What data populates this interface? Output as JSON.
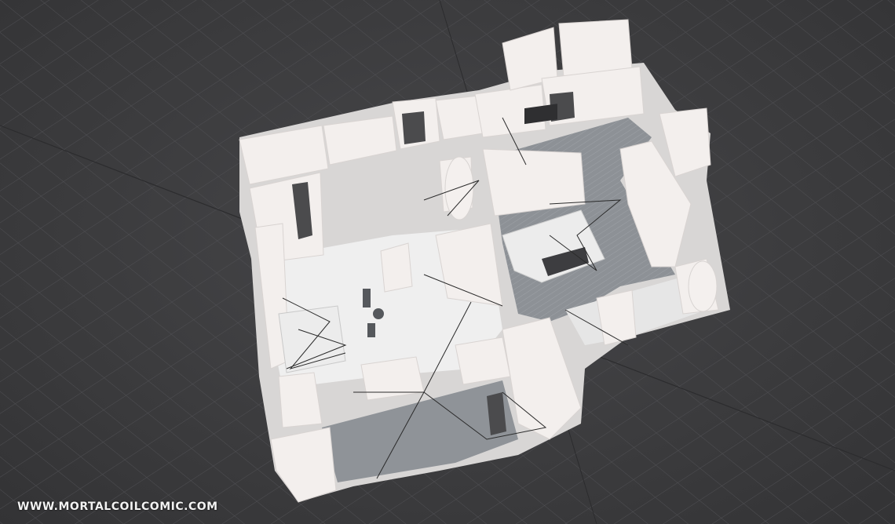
{
  "scene": {
    "description_icon": "3d-floor-plan-render",
    "colors": {
      "background": "#3b3b3d",
      "grid": "#4e4e52",
      "wall": "#f2eeec",
      "floor": "#e9e9ea",
      "dark_floor": "#8b8f94",
      "lines": "#2b2b2b"
    }
  },
  "watermark": {
    "text": "WWW.MORTALCOILCOMIC.COM"
  }
}
